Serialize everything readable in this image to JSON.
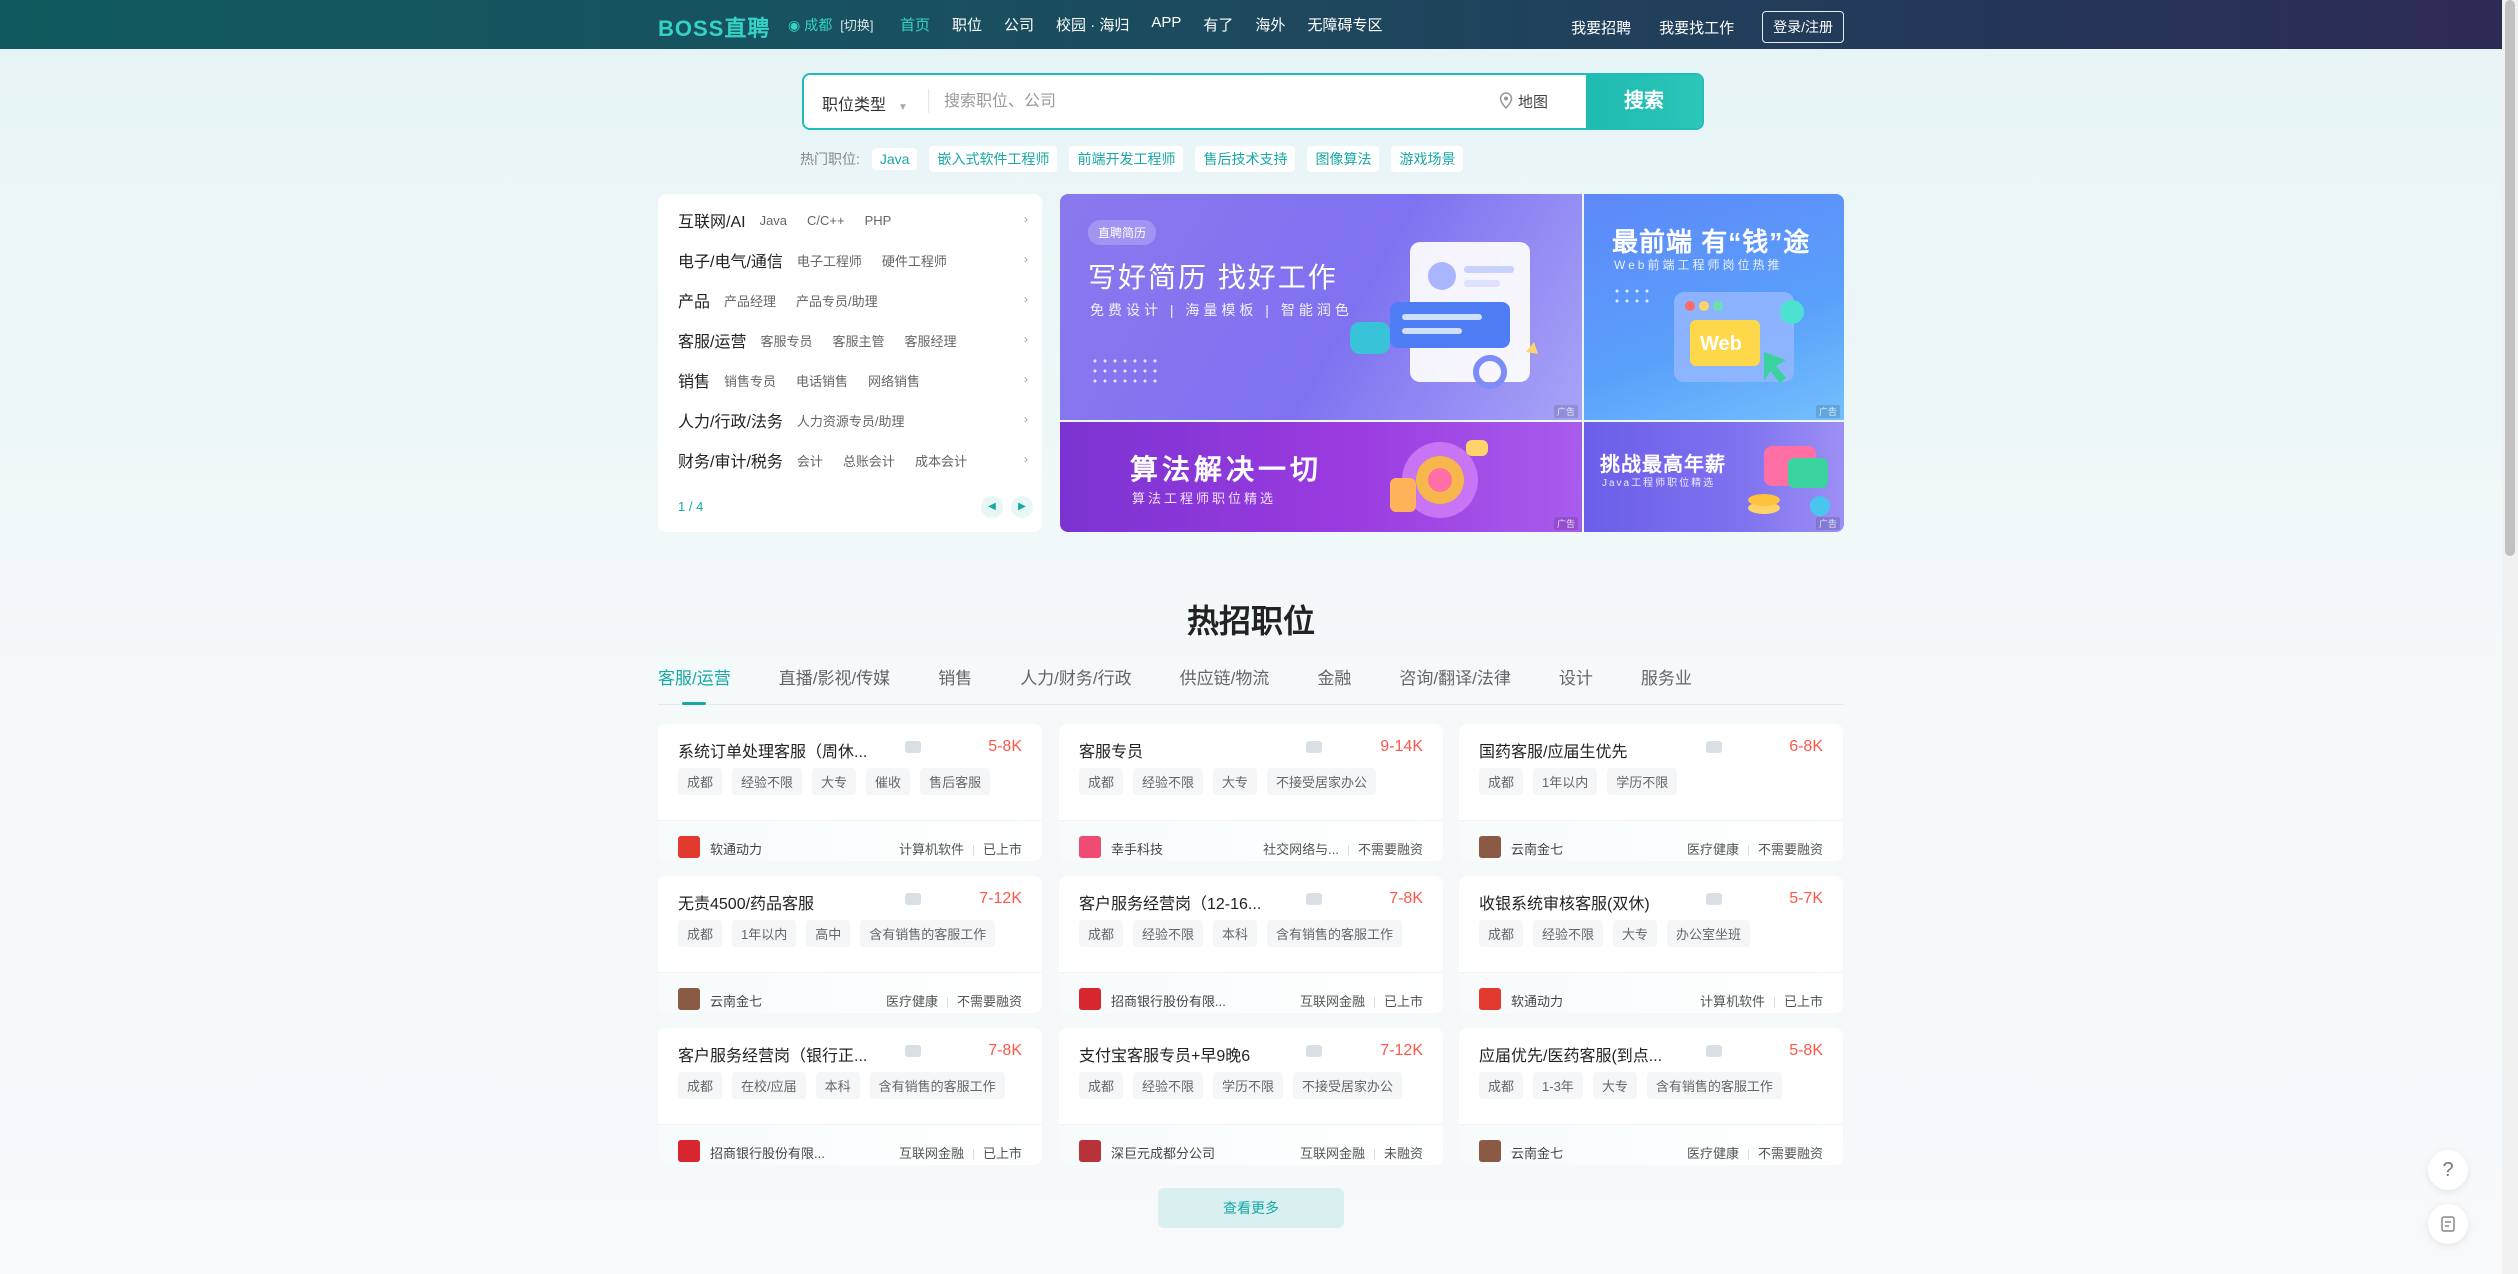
{
  "nav": {
    "logo": "BOSS直聘",
    "city": "成都",
    "city_switch": "[切换]",
    "links": [
      "首页",
      "职位",
      "公司",
      "校园 · 海归",
      "APP",
      "有了",
      "海外",
      "无障碍专区"
    ],
    "right": [
      "我要招聘",
      "我要找工作"
    ],
    "login": "登录/注册"
  },
  "search": {
    "type_label": "职位类型",
    "placeholder": "搜索职位、公司",
    "map_label": "地图",
    "button": "搜索",
    "hot_label": "热门职位:",
    "hot_tags": [
      "Java",
      "嵌入式软件工程师",
      "前端开发工程师",
      "售后技术支持",
      "图像算法",
      "游戏场景"
    ]
  },
  "categories": {
    "rows": [
      {
        "main": "互联网/AI",
        "subs": [
          "Java",
          "C/C++",
          "PHP"
        ]
      },
      {
        "main": "电子/电气/通信",
        "subs": [
          "电子工程师",
          "硬件工程师"
        ]
      },
      {
        "main": "产品",
        "subs": [
          "产品经理",
          "产品专员/助理"
        ]
      },
      {
        "main": "客服/运营",
        "subs": [
          "客服专员",
          "客服主管",
          "客服经理"
        ]
      },
      {
        "main": "销售",
        "subs": [
          "销售专员",
          "电话销售",
          "网络销售"
        ]
      },
      {
        "main": "人力/行政/法务",
        "subs": [
          "人力资源专员/助理"
        ]
      },
      {
        "main": "财务/审计/税务",
        "subs": [
          "会计",
          "总账会计",
          "成本会计"
        ]
      }
    ],
    "page": "1 / 4"
  },
  "banners": {
    "b1": {
      "badge": "直聘简历",
      "title": "写好简历 找好工作",
      "sub": "免费设计 | 海量模板 | 智能润色",
      "ad": "广告"
    },
    "b2": {
      "title": "最前端 有“钱”途",
      "sub": "Web前端工程师岗位热推",
      "ad": "广告"
    },
    "b3": {
      "title": "算法解决一切",
      "sub": "算法工程师职位精选",
      "ad": "广告"
    },
    "b4": {
      "title": "挑战最高年薪",
      "sub": "Java工程师职位精选",
      "ad": "广告"
    }
  },
  "hot_jobs": {
    "title": "热招职位",
    "tabs": [
      "客服/运营",
      "直播/影视/传媒",
      "销售",
      "人力/财务/行政",
      "供应链/物流",
      "金融",
      "咨询/翻译/法律",
      "设计",
      "服务业"
    ],
    "active_tab": 0,
    "more": "查看更多",
    "jobs": [
      {
        "title": "系统订单处理客服（周休...",
        "salary": "5-8K",
        "tags": [
          "成都",
          "经验不限",
          "大专",
          "催收",
          "售后客服"
        ],
        "company": "软通动力",
        "industry": "计算机软件",
        "stage": "已上市",
        "logo_color": "#e23a2e"
      },
      {
        "title": "客服专员",
        "salary": "9-14K",
        "tags": [
          "成都",
          "经验不限",
          "大专",
          "不接受居家办公"
        ],
        "company": "幸手科技",
        "industry": "社交网络与...",
        "stage": "不需要融资",
        "logo_color": "#ef4b73"
      },
      {
        "title": "国药客服/应届生优先",
        "salary": "6-8K",
        "tags": [
          "成都",
          "1年以内",
          "学历不限"
        ],
        "company": "云南金七",
        "industry": "医疗健康",
        "stage": "不需要融资",
        "logo_color": "#8a5a44"
      },
      {
        "title": "无责4500/药品客服",
        "salary": "7-12K",
        "tags": [
          "成都",
          "1年以内",
          "高中",
          "含有销售的客服工作"
        ],
        "company": "云南金七",
        "industry": "医疗健康",
        "stage": "不需要融资",
        "logo_color": "#8a5a44"
      },
      {
        "title": "客户服务经营岗（12-16...",
        "salary": "7-8K",
        "tags": [
          "成都",
          "经验不限",
          "本科",
          "含有销售的客服工作"
        ],
        "company": "招商银行股份有限...",
        "industry": "互联网金融",
        "stage": "已上市",
        "logo_color": "#d8262e"
      },
      {
        "title": "收银系统审核客服(双休)",
        "salary": "5-7K",
        "tags": [
          "成都",
          "经验不限",
          "大专",
          "办公室坐班"
        ],
        "company": "软通动力",
        "industry": "计算机软件",
        "stage": "已上市",
        "logo_color": "#e23a2e"
      },
      {
        "title": "客户服务经营岗（银行正...",
        "salary": "7-8K",
        "tags": [
          "成都",
          "在校/应届",
          "本科",
          "含有销售的客服工作"
        ],
        "company": "招商银行股份有限...",
        "industry": "互联网金融",
        "stage": "已上市",
        "logo_color": "#d8262e"
      },
      {
        "title": "支付宝客服专员+早9晚6",
        "salary": "7-12K",
        "tags": [
          "成都",
          "经验不限",
          "学历不限",
          "不接受居家办公"
        ],
        "company": "深巨元成都分公司",
        "industry": "互联网金融",
        "stage": "未融资",
        "logo_color": "#b8323a"
      },
      {
        "title": "应届优先/医药客服(到点...",
        "salary": "5-8K",
        "tags": [
          "成都",
          "1-3年",
          "大专",
          "含有销售的客服工作"
        ],
        "company": "云南金七",
        "industry": "医疗健康",
        "stage": "不需要融资",
        "logo_color": "#8a5a44"
      }
    ]
  },
  "float": {
    "help": "?"
  }
}
